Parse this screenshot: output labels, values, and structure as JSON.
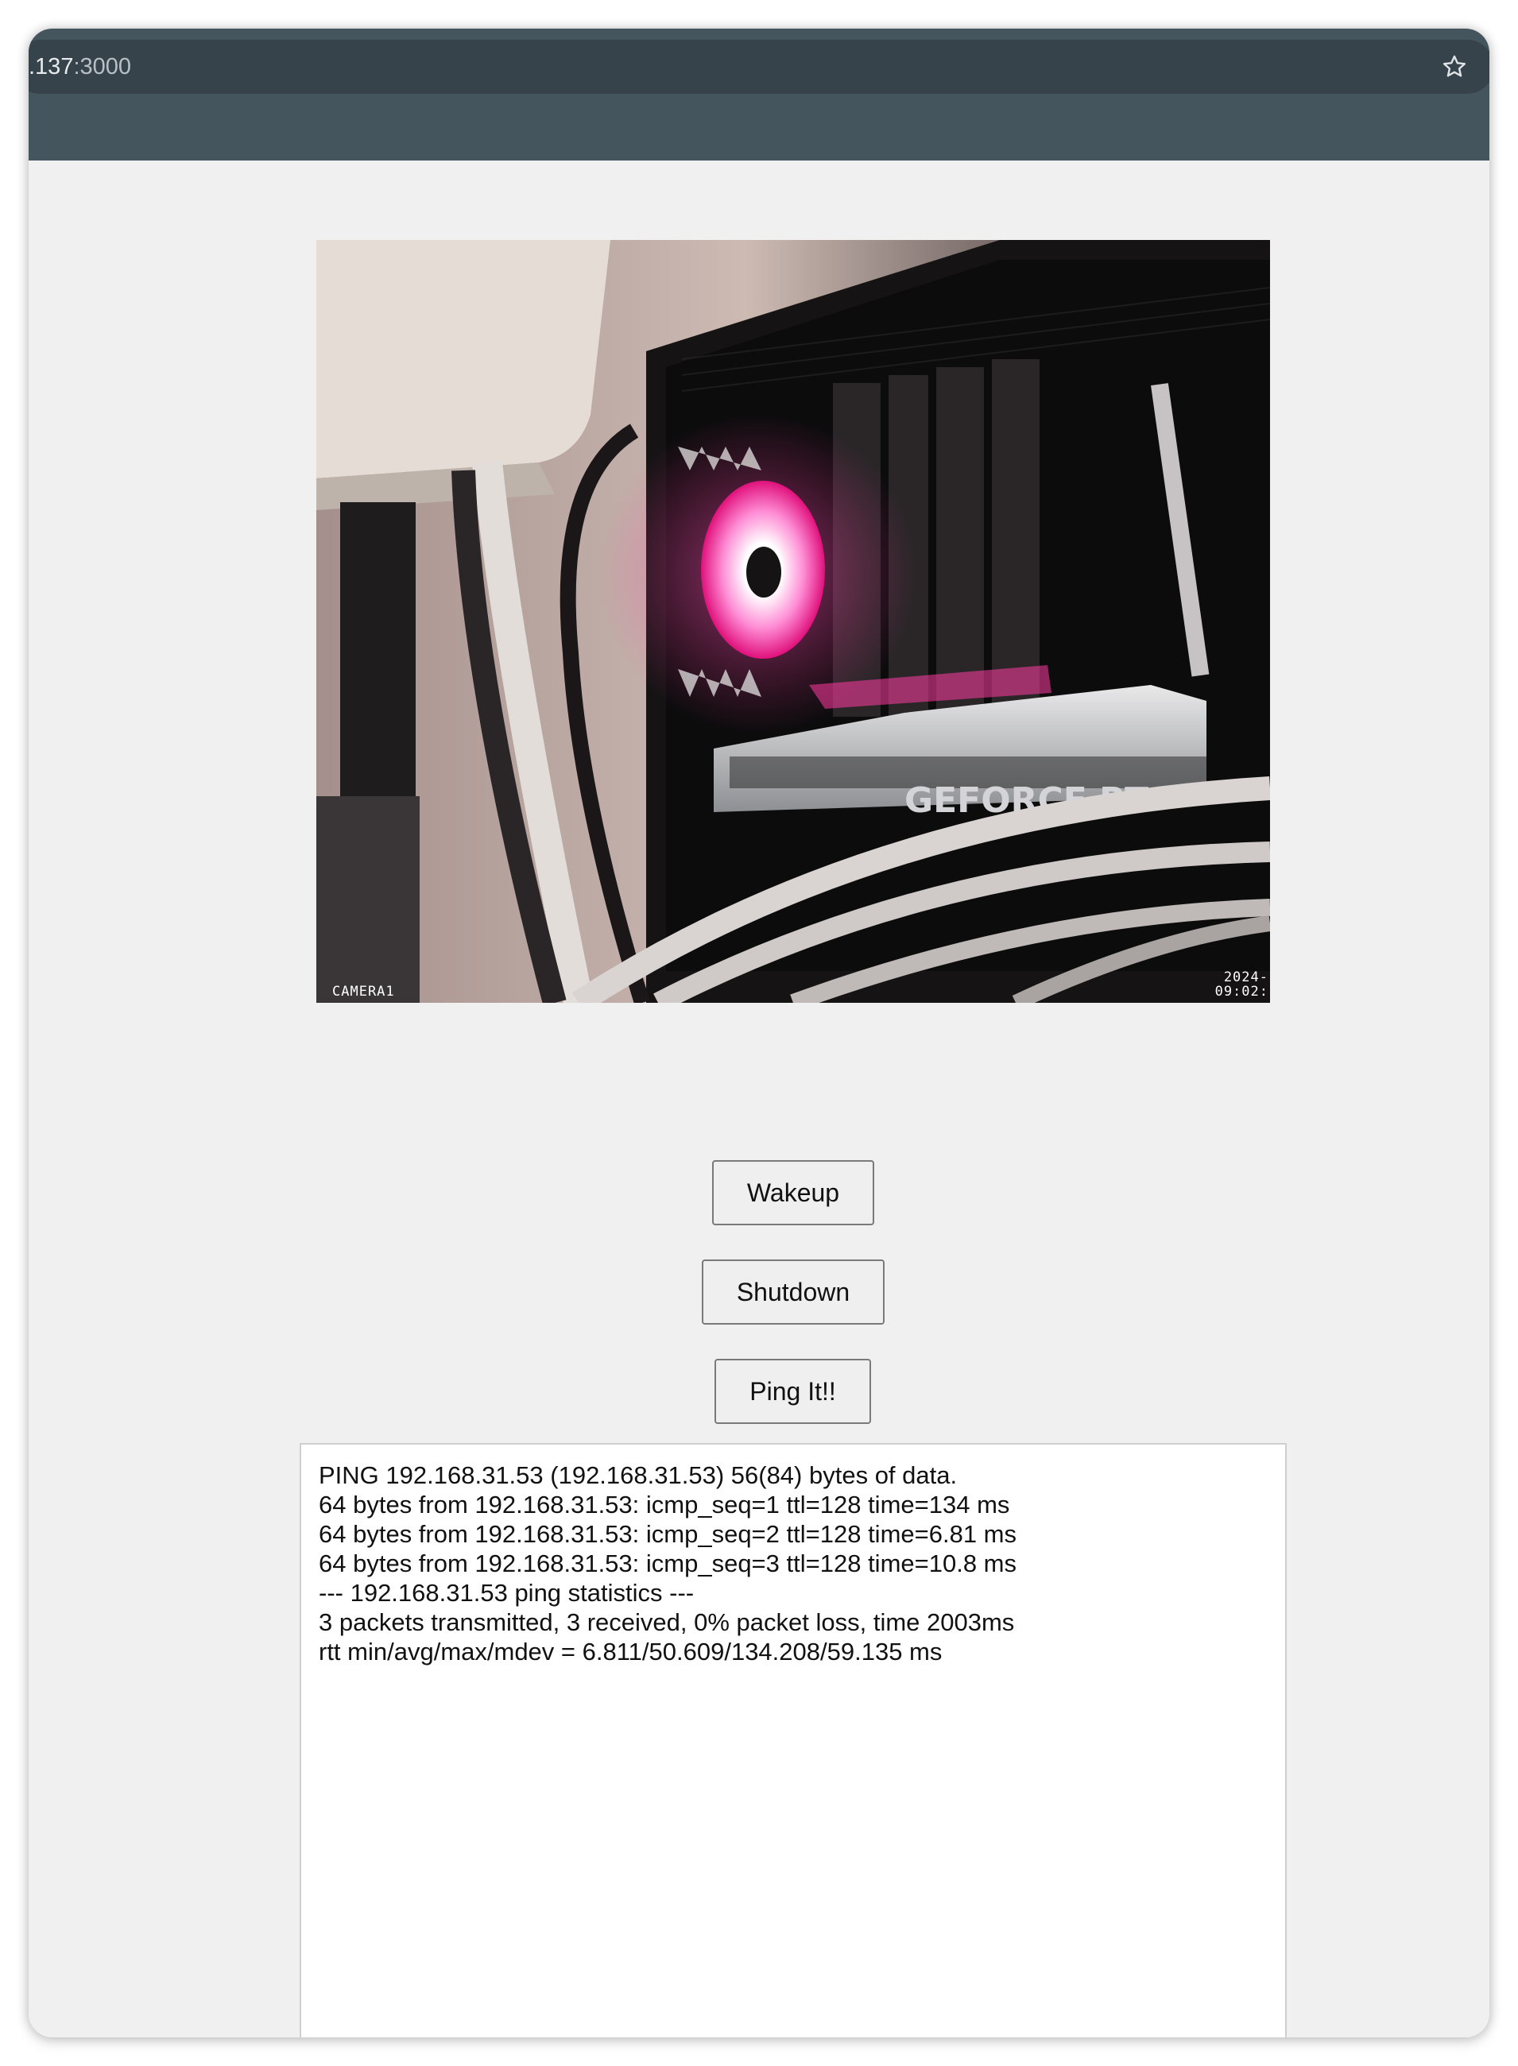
{
  "browser": {
    "url_partial_host": ".137",
    "url_port": ":3000",
    "star_icon": "star-outline-icon"
  },
  "camera": {
    "name_overlay": "CAMERA1",
    "timestamp_line1": "2024-",
    "timestamp_line2": "09:02:",
    "visible_text": "GEFORCE RT"
  },
  "buttons": {
    "wakeup": "Wakeup",
    "shutdown": "Shutdown",
    "ping": "Ping It!!"
  },
  "output": {
    "lines": [
      "PING 192.168.31.53 (192.168.31.53) 56(84) bytes of data.",
      "64 bytes from 192.168.31.53: icmp_seq=1 ttl=128 time=134 ms",
      "64 bytes from 192.168.31.53: icmp_seq=2 ttl=128 time=6.81 ms",
      "64 bytes from 192.168.31.53: icmp_seq=3 ttl=128 time=10.8 ms",
      "--- 192.168.31.53 ping statistics ---",
      "3 packets transmitted, 3 received, 0% packet loss, time 2003ms",
      "rtt min/avg/max/mdev = 6.811/50.609/134.208/59.135 ms"
    ]
  },
  "colors": {
    "toolbar": "#45555e",
    "omnibox": "#37434a",
    "page_background": "#f0f0f0",
    "fan_glow": "#ff2f9a"
  }
}
